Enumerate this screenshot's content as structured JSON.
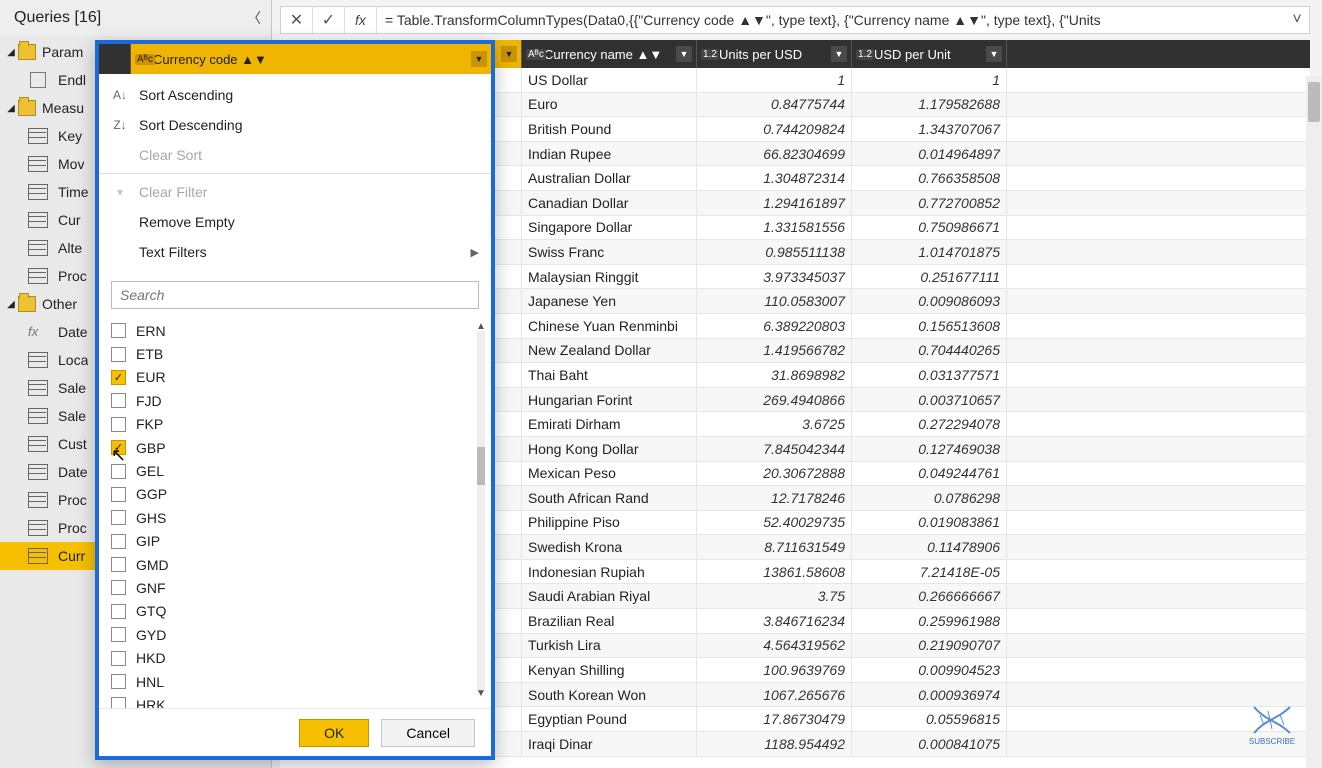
{
  "formula_bar": {
    "text": "= Table.TransformColumnTypes(Data0,{{\"Currency code ▲▼\", type text}, {\"Currency name ▲▼\", type text}, {\"Units"
  },
  "queries": {
    "header": "Queries [16]",
    "folders": [
      {
        "name": "Param",
        "items": [
          {
            "label": "Endl",
            "kind": "param"
          }
        ]
      },
      {
        "name": "Measu",
        "items": [
          {
            "label": "Key",
            "kind": "table"
          },
          {
            "label": "Mov",
            "kind": "table"
          },
          {
            "label": "Time",
            "kind": "table"
          },
          {
            "label": "Cur",
            "kind": "table"
          },
          {
            "label": "Alte",
            "kind": "table"
          },
          {
            "label": "Proc",
            "kind": "table"
          }
        ]
      },
      {
        "name": "Other",
        "items": [
          {
            "label": "Date",
            "kind": "fx"
          },
          {
            "label": "Loca",
            "kind": "table"
          },
          {
            "label": "Sale",
            "kind": "table"
          },
          {
            "label": "Sale",
            "kind": "table"
          },
          {
            "label": "Cust",
            "kind": "table"
          },
          {
            "label": "Date",
            "kind": "table"
          },
          {
            "label": "Proc",
            "kind": "table"
          },
          {
            "label": "Proc",
            "kind": "table"
          },
          {
            "label": "Curr",
            "kind": "table",
            "selected": true
          }
        ]
      }
    ]
  },
  "grid": {
    "columns": {
      "code": {
        "label": "Currency code ▲▼",
        "type": "Aᴮc"
      },
      "name": {
        "label": "Currency name ▲▼",
        "type": "Aᴮc"
      },
      "units": {
        "label": "Units per USD",
        "type": "1.2"
      },
      "usd": {
        "label": "USD per Unit",
        "type": "1.2"
      }
    },
    "rows": [
      {
        "name": "US Dollar",
        "units": "1",
        "usd": "1"
      },
      {
        "name": "Euro",
        "units": "0.84775744",
        "usd": "1.179582688"
      },
      {
        "name": "British Pound",
        "units": "0.744209824",
        "usd": "1.343707067"
      },
      {
        "name": "Indian Rupee",
        "units": "66.82304699",
        "usd": "0.014964897"
      },
      {
        "name": "Australian Dollar",
        "units": "1.304872314",
        "usd": "0.766358508"
      },
      {
        "name": "Canadian Dollar",
        "units": "1.294161897",
        "usd": "0.772700852"
      },
      {
        "name": "Singapore Dollar",
        "units": "1.331581556",
        "usd": "0.750986671"
      },
      {
        "name": "Swiss Franc",
        "units": "0.985511138",
        "usd": "1.014701875"
      },
      {
        "name": "Malaysian Ringgit",
        "units": "3.973345037",
        "usd": "0.251677111"
      },
      {
        "name": "Japanese Yen",
        "units": "110.0583007",
        "usd": "0.009086093"
      },
      {
        "name": "Chinese Yuan Renminbi",
        "units": "6.389220803",
        "usd": "0.156513608"
      },
      {
        "name": "New Zealand Dollar",
        "units": "1.419566782",
        "usd": "0.704440265"
      },
      {
        "name": "Thai Baht",
        "units": "31.8698982",
        "usd": "0.031377571"
      },
      {
        "name": "Hungarian Forint",
        "units": "269.4940866",
        "usd": "0.003710657"
      },
      {
        "name": "Emirati Dirham",
        "units": "3.6725",
        "usd": "0.272294078"
      },
      {
        "name": "Hong Kong Dollar",
        "units": "7.845042344",
        "usd": "0.127469038"
      },
      {
        "name": "Mexican Peso",
        "units": "20.30672888",
        "usd": "0.049244761"
      },
      {
        "name": "South African Rand",
        "units": "12.7178246",
        "usd": "0.0786298"
      },
      {
        "name": "Philippine Piso",
        "units": "52.40029735",
        "usd": "0.019083861"
      },
      {
        "name": "Swedish Krona",
        "units": "8.711631549",
        "usd": "0.11478906"
      },
      {
        "name": "Indonesian Rupiah",
        "units": "13861.58608",
        "usd": "7.21418E-05"
      },
      {
        "name": "Saudi Arabian Riyal",
        "units": "3.75",
        "usd": "0.266666667"
      },
      {
        "name": "Brazilian Real",
        "units": "3.846716234",
        "usd": "0.259961988"
      },
      {
        "name": "Turkish Lira",
        "units": "4.564319562",
        "usd": "0.219090707"
      },
      {
        "name": "Kenyan Shilling",
        "units": "100.9639769",
        "usd": "0.009904523"
      },
      {
        "name": "South Korean Won",
        "units": "1067.265676",
        "usd": "0.000936974"
      },
      {
        "name": "Egyptian Pound",
        "units": "17.86730479",
        "usd": "0.05596815"
      },
      {
        "name": "Iraqi Dinar",
        "units": "1188.954492",
        "usd": "0.000841075"
      }
    ]
  },
  "filter": {
    "column_label": "Currency code ▲▼",
    "sort_asc": "Sort Ascending",
    "sort_desc": "Sort Descending",
    "clear_sort": "Clear Sort",
    "clear_filter": "Clear Filter",
    "remove_empty": "Remove Empty",
    "text_filters": "Text Filters",
    "search_placeholder": "Search",
    "items": [
      {
        "code": "ERN",
        "checked": false
      },
      {
        "code": "ETB",
        "checked": false
      },
      {
        "code": "EUR",
        "checked": true
      },
      {
        "code": "FJD",
        "checked": false
      },
      {
        "code": "FKP",
        "checked": false
      },
      {
        "code": "GBP",
        "checked": true
      },
      {
        "code": "GEL",
        "checked": false
      },
      {
        "code": "GGP",
        "checked": false
      },
      {
        "code": "GHS",
        "checked": false
      },
      {
        "code": "GIP",
        "checked": false
      },
      {
        "code": "GMD",
        "checked": false
      },
      {
        "code": "GNF",
        "checked": false
      },
      {
        "code": "GTQ",
        "checked": false
      },
      {
        "code": "GYD",
        "checked": false
      },
      {
        "code": "HKD",
        "checked": false
      },
      {
        "code": "HNL",
        "checked": false
      },
      {
        "code": "HRK",
        "checked": false
      }
    ],
    "scroll_thumb": {
      "top_pct": 33,
      "height_pct": 10
    },
    "ok": "OK",
    "cancel": "Cancel"
  },
  "subscribe_label": "SUBSCRIBE"
}
